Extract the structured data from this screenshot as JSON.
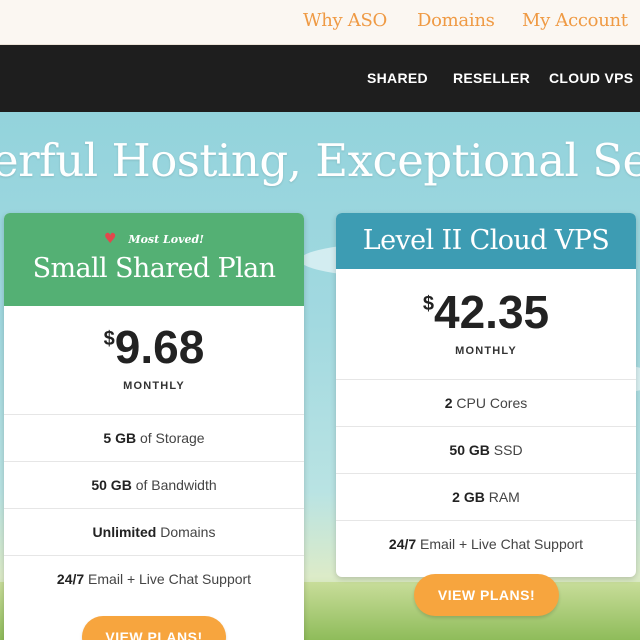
{
  "topnav": {
    "why": "Why ASO",
    "domains": "Domains",
    "account": "My Account"
  },
  "mainnav": {
    "shared": "SHARED",
    "reseller": "RESELLER",
    "cloud": "CLOUD VPS"
  },
  "hero": {
    "headline": "erful Hosting, Exceptional Ser"
  },
  "cards": [
    {
      "badge": "Most Loved!",
      "badge_icon": "heart-icon",
      "title": "Small Shared Plan",
      "currency": "$",
      "price": "9.68",
      "period": "MONTHLY",
      "header_color": "#54b074",
      "features": [
        {
          "strong": "5 GB",
          "rest": " of Storage"
        },
        {
          "strong": "50 GB",
          "rest": " of Bandwidth"
        },
        {
          "strong": "Unlimited",
          "rest": " Domains"
        },
        {
          "strong": "24/7",
          "rest": " Email + Live Chat Support"
        }
      ],
      "button": "VIEW PLANS!"
    },
    {
      "title": "Level II Cloud VPS",
      "currency": "$",
      "price": "42.35",
      "period": "MONTHLY",
      "header_color": "#3d9cb3",
      "features": [
        {
          "strong": "2",
          "rest": " CPU Cores"
        },
        {
          "strong": "50 GB",
          "rest": " SSD"
        },
        {
          "strong": "2 GB",
          "rest": " RAM"
        },
        {
          "strong": "24/7",
          "rest": " Email + Live Chat Support"
        }
      ],
      "button": "VIEW PLANS!"
    }
  ],
  "colors": {
    "accent_orange": "#f7a53e",
    "link_orange": "#ef9a44",
    "nav_dark": "#1e1e1e"
  }
}
